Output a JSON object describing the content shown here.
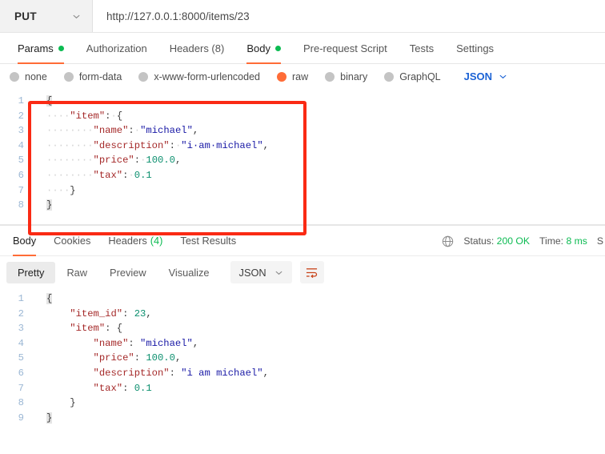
{
  "urlbar": {
    "method": "PUT",
    "method_icon": "chevron-down-icon",
    "url": "http://127.0.0.1:8000/items/23"
  },
  "request_tabs": [
    {
      "label": "Params",
      "has_dot": true,
      "active": false
    },
    {
      "label": "Authorization",
      "has_dot": false,
      "active": false
    },
    {
      "label": "Headers (8)",
      "has_dot": false,
      "active": false
    },
    {
      "label": "Body",
      "has_dot": true,
      "active": true
    },
    {
      "label": "Pre-request Script",
      "has_dot": false,
      "active": false
    },
    {
      "label": "Tests",
      "has_dot": false,
      "active": false
    },
    {
      "label": "Settings",
      "has_dot": false,
      "active": false
    }
  ],
  "body_types": [
    {
      "label": "none",
      "selected": false
    },
    {
      "label": "form-data",
      "selected": false
    },
    {
      "label": "x-www-form-urlencoded",
      "selected": false
    },
    {
      "label": "raw",
      "selected": true
    },
    {
      "label": "binary",
      "selected": false
    },
    {
      "label": "GraphQL",
      "selected": false
    }
  ],
  "body_format": {
    "label": "JSON",
    "icon": "chevron-down-icon"
  },
  "request_body": {
    "lines": [
      {
        "num": "1",
        "tokens": [
          {
            "t": "{",
            "c": "p brace-hl"
          }
        ]
      },
      {
        "num": "2",
        "tokens": [
          {
            "t": "····",
            "c": "ws"
          },
          {
            "t": "\"item\"",
            "c": "k"
          },
          {
            "t": ":",
            "c": "p"
          },
          {
            "t": "·",
            "c": "ws"
          },
          {
            "t": "{",
            "c": "p"
          }
        ]
      },
      {
        "num": "3",
        "tokens": [
          {
            "t": "····",
            "c": "ws"
          },
          {
            "t": "····",
            "c": "ws"
          },
          {
            "t": "\"name\"",
            "c": "k"
          },
          {
            "t": ":",
            "c": "p"
          },
          {
            "t": "·",
            "c": "ws"
          },
          {
            "t": "\"michael\"",
            "c": "s"
          },
          {
            "t": ",",
            "c": "p"
          }
        ]
      },
      {
        "num": "4",
        "tokens": [
          {
            "t": "····",
            "c": "ws"
          },
          {
            "t": "····",
            "c": "ws"
          },
          {
            "t": "\"description\"",
            "c": "k"
          },
          {
            "t": ":",
            "c": "p"
          },
          {
            "t": "·",
            "c": "ws"
          },
          {
            "t": "\"i·am·michael\"",
            "c": "s"
          },
          {
            "t": ",",
            "c": "p"
          }
        ]
      },
      {
        "num": "5",
        "tokens": [
          {
            "t": "····",
            "c": "ws"
          },
          {
            "t": "····",
            "c": "ws"
          },
          {
            "t": "\"price\"",
            "c": "k"
          },
          {
            "t": ":",
            "c": "p"
          },
          {
            "t": "·",
            "c": "ws"
          },
          {
            "t": "100.0",
            "c": "n"
          },
          {
            "t": ",",
            "c": "p"
          }
        ]
      },
      {
        "num": "6",
        "tokens": [
          {
            "t": "····",
            "c": "ws"
          },
          {
            "t": "····",
            "c": "ws"
          },
          {
            "t": "\"tax\"",
            "c": "k"
          },
          {
            "t": ":",
            "c": "p"
          },
          {
            "t": "·",
            "c": "ws"
          },
          {
            "t": "0.1",
            "c": "n"
          }
        ]
      },
      {
        "num": "7",
        "tokens": [
          {
            "t": "····",
            "c": "ws"
          },
          {
            "t": "}",
            "c": "p"
          }
        ]
      },
      {
        "num": "8",
        "tokens": [
          {
            "t": "}",
            "c": "p brace-hl"
          }
        ]
      }
    ]
  },
  "response_tabs": [
    {
      "label": "Body",
      "count": "",
      "active": true
    },
    {
      "label": "Cookies",
      "count": "",
      "active": false
    },
    {
      "label": "Headers",
      "count": "(4)",
      "active": false
    },
    {
      "label": "Test Results",
      "count": "",
      "active": false
    }
  ],
  "response_status": {
    "globe_icon": "globe-icon",
    "status_label": "Status:",
    "status_value": "200 OK",
    "time_label": "Time:",
    "time_value": "8 ms",
    "size_label": "S"
  },
  "response_toolbar": {
    "views": [
      {
        "label": "Pretty",
        "active": true
      },
      {
        "label": "Raw",
        "active": false
      },
      {
        "label": "Preview",
        "active": false
      },
      {
        "label": "Visualize",
        "active": false
      }
    ],
    "format": {
      "label": "JSON",
      "icon": "chevron-down-icon"
    },
    "wrap_icon": "word-wrap-icon"
  },
  "response_body": {
    "lines": [
      {
        "num": "1",
        "tokens": [
          {
            "t": "{",
            "c": "p brace-hl"
          }
        ]
      },
      {
        "num": "2",
        "tokens": [
          {
            "t": "    ",
            "c": "p"
          },
          {
            "t": "\"item_id\"",
            "c": "k"
          },
          {
            "t": ": ",
            "c": "p"
          },
          {
            "t": "23",
            "c": "n"
          },
          {
            "t": ",",
            "c": "p"
          }
        ]
      },
      {
        "num": "3",
        "tokens": [
          {
            "t": "    ",
            "c": "p"
          },
          {
            "t": "\"item\"",
            "c": "k"
          },
          {
            "t": ": {",
            "c": "p"
          }
        ]
      },
      {
        "num": "4",
        "tokens": [
          {
            "t": "        ",
            "c": "p"
          },
          {
            "t": "\"name\"",
            "c": "k"
          },
          {
            "t": ": ",
            "c": "p"
          },
          {
            "t": "\"michael\"",
            "c": "s"
          },
          {
            "t": ",",
            "c": "p"
          }
        ]
      },
      {
        "num": "5",
        "tokens": [
          {
            "t": "        ",
            "c": "p"
          },
          {
            "t": "\"price\"",
            "c": "k"
          },
          {
            "t": ": ",
            "c": "p"
          },
          {
            "t": "100.0",
            "c": "n"
          },
          {
            "t": ",",
            "c": "p"
          }
        ]
      },
      {
        "num": "6",
        "tokens": [
          {
            "t": "        ",
            "c": "p"
          },
          {
            "t": "\"description\"",
            "c": "k"
          },
          {
            "t": ": ",
            "c": "p"
          },
          {
            "t": "\"i am michael\"",
            "c": "s"
          },
          {
            "t": ",",
            "c": "p"
          }
        ]
      },
      {
        "num": "7",
        "tokens": [
          {
            "t": "        ",
            "c": "p"
          },
          {
            "t": "\"tax\"",
            "c": "k"
          },
          {
            "t": ": ",
            "c": "p"
          },
          {
            "t": "0.1",
            "c": "n"
          }
        ]
      },
      {
        "num": "8",
        "tokens": [
          {
            "t": "    }",
            "c": "p"
          }
        ]
      },
      {
        "num": "9",
        "tokens": [
          {
            "t": "}",
            "c": "p brace-hl"
          }
        ]
      }
    ]
  },
  "annotation": {
    "shape": "rectangle",
    "color": "#fa2a14"
  }
}
